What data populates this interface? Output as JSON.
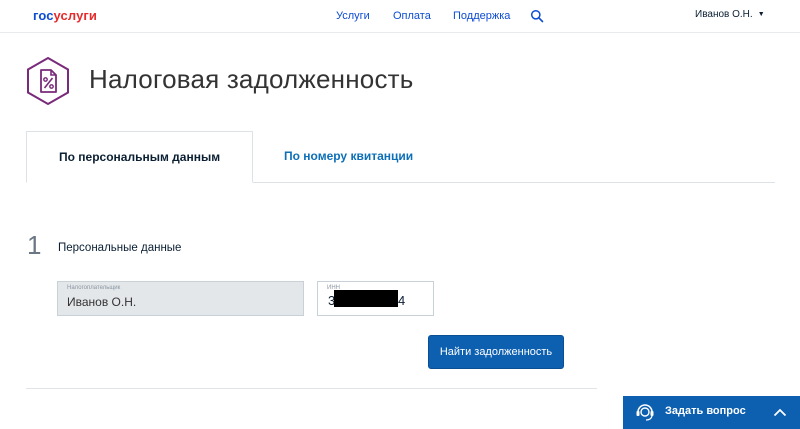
{
  "header": {
    "logo_part1": "гос",
    "logo_part2": "услуги",
    "nav": [
      "Услуги",
      "Оплата",
      "Поддержка"
    ],
    "user_name": "Иванов О.Н.",
    "user_caret": "▼"
  },
  "page": {
    "title": "Налоговая задолженность",
    "icon": "tax-percent-document-icon"
  },
  "tabs": [
    {
      "label": "По персональным данным",
      "active": true
    },
    {
      "label": "По номеру квитанции",
      "active": false
    }
  ],
  "step": {
    "number": "1",
    "label": "Персональные данные"
  },
  "fields": {
    "taxpayer": {
      "label": "Налогоплательщик",
      "value": "Иванов О.Н."
    },
    "inn": {
      "label": "ИНН",
      "value_start": "3",
      "value_end": "4"
    }
  },
  "actions": {
    "find_debt": "Найти задолженность"
  },
  "ask_widget": {
    "label": "Задать вопрос"
  },
  "colors": {
    "brand_blue": "#0d4cd3",
    "brand_red": "#e52b2b",
    "button_blue": "#0d5fb0",
    "icon_purple": "#7a2a7a",
    "tab_link": "#0d6fb8"
  }
}
